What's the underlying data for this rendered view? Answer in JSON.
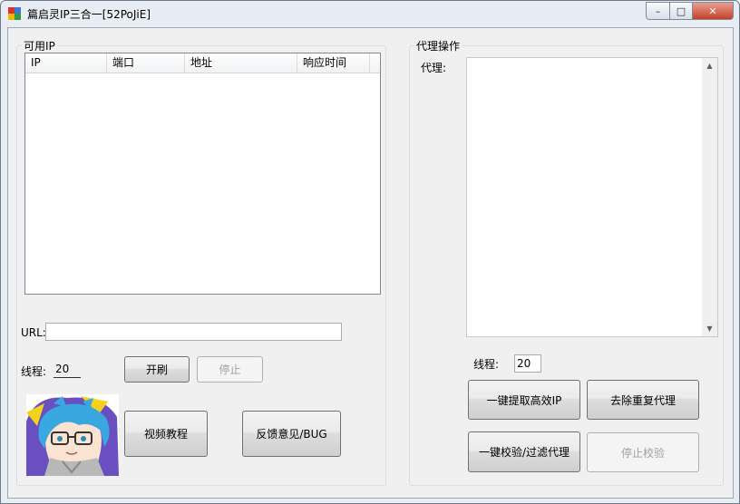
{
  "window": {
    "title": "篇启灵IP三合一[52PoJiE]",
    "controls": {
      "minimize": "–",
      "maximize": "□",
      "close": "✕"
    }
  },
  "left_panel": {
    "group_title": "可用IP",
    "columns": [
      "IP",
      "端口",
      "地址",
      "响应时间"
    ],
    "url_label": "URL:",
    "url_value": "",
    "threads_label": "线程:",
    "threads_value": "20",
    "start_button": "开刷",
    "stop_button": "停止",
    "video_button": "视频教程",
    "feedback_button": "反馈意见/BUG"
  },
  "right_panel": {
    "group_title": "代理操作",
    "proxy_label": "代理:",
    "proxy_value": "",
    "threads_label": "线程:",
    "threads_value": "20",
    "extract_button": "一键提取高效IP",
    "dedupe_button": "去除重复代理",
    "verify_button": "一键校验/过滤代理",
    "stop_verify_button": "停止校验"
  },
  "colors": {
    "accent_close": "#c7402a",
    "avatar_hair": "#3aa8e0",
    "avatar_bg": "#6a4fc0"
  }
}
